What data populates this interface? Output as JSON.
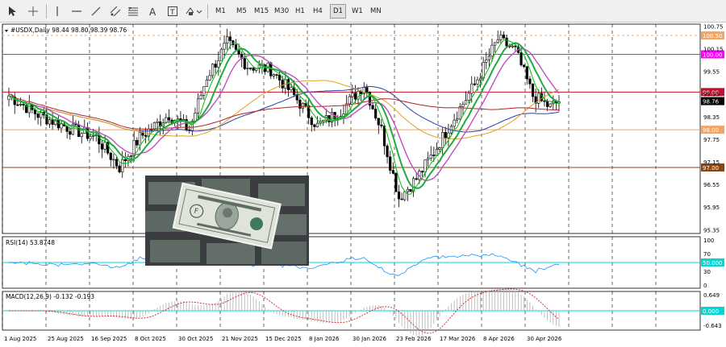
{
  "toolbar": {
    "timeframes": [
      "M1",
      "M5",
      "M15",
      "M30",
      "H1",
      "H4",
      "D1",
      "W1",
      "MN"
    ],
    "active_timeframe": "D1",
    "icons": [
      "cursor-icon",
      "crosshair-icon",
      "vertical-line-icon",
      "horizontal-line-icon",
      "trendline-icon",
      "channel-icon",
      "fibonacci-icon",
      "text-icon",
      "text-label-icon",
      "shapes-icon"
    ]
  },
  "main_chart": {
    "title": "#USDX,Daily  98.44 98.80 98.39 98.76",
    "price_scale": [
      "100.75",
      "100.15",
      "99.55",
      "98.95",
      "98.35",
      "97.75",
      "97.15",
      "96.55",
      "95.95",
      "95.35"
    ],
    "level_labels": [
      {
        "text": "100.50",
        "price": 100.5,
        "color": "#f4a460"
      },
      {
        "text": "100.00",
        "price": 100.0,
        "color": "#ff00ff"
      },
      {
        "text": "99.00",
        "price": 99.0,
        "color": "#c8102e"
      },
      {
        "text": "98.00",
        "price": 98.0,
        "color": "#f4a460"
      },
      {
        "text": "97.00",
        "price": 97.0,
        "color": "#8b4513"
      }
    ],
    "current_price": "98.76",
    "price_range": [
      95.25,
      100.8
    ]
  },
  "rsi": {
    "title": "RSI(14) 53.8748",
    "scale": [
      "100",
      "70",
      "50.000",
      "30",
      "0"
    ],
    "level_label": "50.000"
  },
  "macd": {
    "title": "MACD(12,26,9) -0.132 -0.193",
    "scale": [
      "0.649",
      "0.000",
      "-0.643"
    ],
    "zero_label": "0.000"
  },
  "date_axis": [
    "1 Aug 2025",
    "25 Aug 2025",
    "16 Sep 2025",
    "8 Oct 2025",
    "30 Oct 2025",
    "21 Nov 2025",
    "15 Dec 2025",
    "8 Jan 2026",
    "30 Jan 2026",
    "23 Feb 2026",
    "17 Mar 2026",
    "8 Apr 2026",
    "30 Apr 2026"
  ],
  "colors": {
    "bull_candle": "#ffffff",
    "bear_candle": "#000000",
    "ma_fast": "#00aa00",
    "ma_slow": "#22aa44",
    "ma_violet": "#c050c0",
    "ma_orange": "#e0a020",
    "ma_blue": "#2b3fa8",
    "ma_red": "#b22222",
    "rsi_line": "#1e90ff",
    "macd_signal": "#d62020",
    "macd_hist": "#b0b0b0",
    "level_cyan": "#00d7d7"
  }
}
